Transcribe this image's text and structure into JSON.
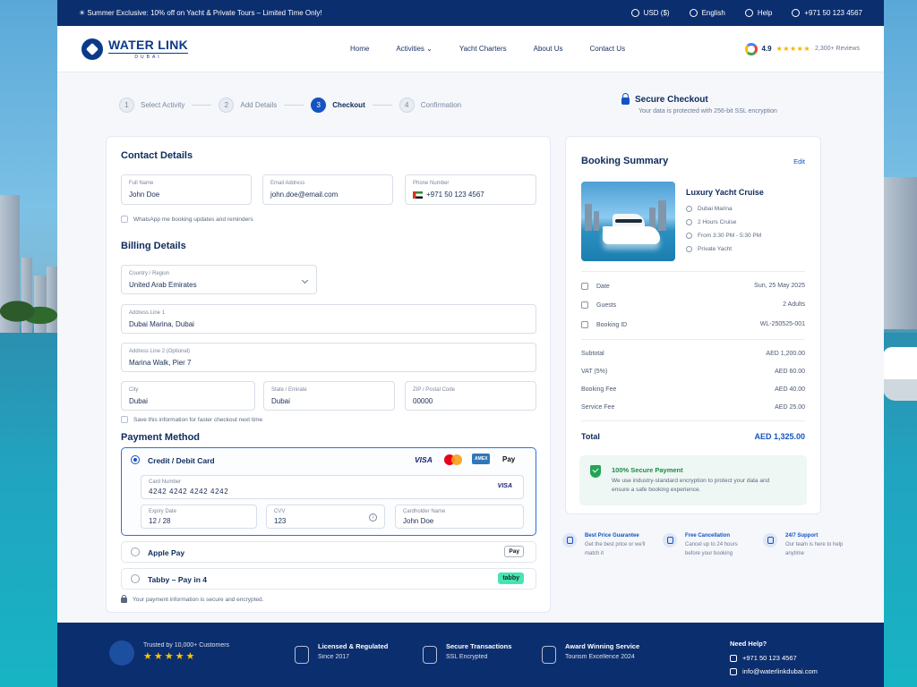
{
  "promo": "☀ Summer Exclusive: 10% off on Yacht & Private Tours – Limited Time Only!",
  "topbar": {
    "currency": "USD ($)",
    "language": "English",
    "help": "Help",
    "phone": "+971 50 123 4567"
  },
  "brand": {
    "name": "WATER LINK",
    "sub": "DUBAI"
  },
  "nav": [
    "Home",
    "Activities",
    "Yacht Charters",
    "About Us",
    "Contact Us"
  ],
  "rating": {
    "score": "4.9",
    "stars": "★★★★★",
    "reviews": "2,300+ Reviews"
  },
  "steps": [
    {
      "num": "1",
      "label": "Select Activity"
    },
    {
      "num": "2",
      "label": "Add Details"
    },
    {
      "num": "3",
      "label": "Checkout"
    },
    {
      "num": "4",
      "label": "Confirmation"
    }
  ],
  "secure_checkout": {
    "title": "Secure Checkout",
    "sub": "Your data is protected with 256-bit SSL encryption"
  },
  "contact": {
    "title": "Contact Details",
    "full_name": {
      "label": "Full Name",
      "value": "John Doe"
    },
    "email": {
      "label": "Email Address",
      "value": "john.doe@email.com"
    },
    "phone": {
      "label": "Phone Number",
      "value": "+971  50 123 4567"
    },
    "whatsapp": "WhatsApp me booking updates and reminders"
  },
  "billing": {
    "title": "Billing Details",
    "country": {
      "label": "Country / Region",
      "value": "United Arab Emirates"
    },
    "addr1": {
      "label": "Address Line 1",
      "value": "Dubai Marina, Dubai"
    },
    "addr2": {
      "label": "Address Line 2 (Optional)",
      "value": "Marina Walk, Pier 7"
    },
    "city": {
      "label": "City",
      "value": "Dubai"
    },
    "state": {
      "label": "State / Emirate",
      "value": "Dubai"
    },
    "zip": {
      "label": "ZIP / Postal Code",
      "value": "00000"
    },
    "save": "Save this information for faster checkout next time"
  },
  "payment": {
    "title": "Payment Method",
    "card_label": "Credit / Debit Card",
    "brands": {
      "visa": "VISA",
      "amex": "AMEX",
      "apple_pay": "Pay"
    },
    "card_number": {
      "label": "Card Number",
      "value": "4242 4242 4242 4242",
      "brand": "VISA"
    },
    "expiry": {
      "label": "Expiry Date",
      "value": "12 / 28"
    },
    "cvv": {
      "label": "CVV",
      "value": "123"
    },
    "holder": {
      "label": "Cardholder Name",
      "value": "John Doe"
    },
    "apple_label": "Apple Pay",
    "apple_badge": "Pay",
    "tabby_label": "Tabby – Pay in 4",
    "tabby_badge": "tabby",
    "note": "Your payment information is secure and encrypted."
  },
  "summary": {
    "title": "Booking Summary",
    "edit": "Edit",
    "tour": "Luxury Yacht Cruise",
    "location": "Dubai Marina",
    "duration": "2 Hours Cruise",
    "time": "From 3:30 PM - 5:30 PM",
    "type": "Private Yacht",
    "date_k": "Date",
    "date_v": "Sun, 25 May 2025",
    "guests_k": "Guests",
    "guests_v": "2 Adults",
    "booking_k": "Booking ID",
    "booking_v": "WL-250525-001",
    "subtotal_k": "Subtotal",
    "subtotal_v": "AED 1,200.00",
    "vat_k": "VAT (5%)",
    "vat_v": "AED 60.00",
    "fee_k": "Booking Fee",
    "fee_v": "AED 40.00",
    "service_k": "Service Fee",
    "service_v": "AED 25.00",
    "total_k": "Total",
    "total_v": "AED 1,325.00",
    "secure_title": "100% Secure Payment",
    "secure_text": "We use industry-standard encryption to protect your data and ensure a safe booking experience."
  },
  "features": [
    {
      "title": "Best Price Guarantee",
      "sub": "Get the best price or we'll match it"
    },
    {
      "title": "Free Cancellation",
      "sub": "Cancel up to 24 hours before your booking"
    },
    {
      "title": "24/7 Support",
      "sub": "Our team is here to help anytime"
    }
  ],
  "footer": {
    "trusted": "Trusted by 10,000+ Customers",
    "stars": "★★★★★",
    "licensed_t": "Licensed & Regulated",
    "licensed_s": "Since 2017",
    "secure_t": "Secure Transactions",
    "secure_s": "SSL Encrypted",
    "award_t": "Award Winning Service",
    "award_s": "Tourism Excellence 2024",
    "help_t": "Need Help?",
    "help_phone": "+971 50 123 4567",
    "help_email": "info@waterlinkdubai.com"
  }
}
